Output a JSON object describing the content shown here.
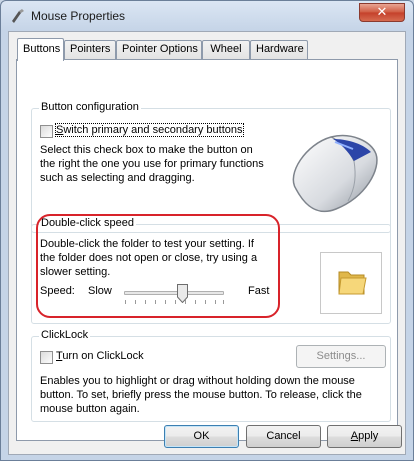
{
  "window": {
    "title": "Mouse Properties",
    "close_glyph": "✕"
  },
  "tabs": [
    {
      "label": "Buttons",
      "active": true
    },
    {
      "label": "Pointers",
      "active": false
    },
    {
      "label": "Pointer Options",
      "active": false
    },
    {
      "label": "Wheel",
      "active": false
    },
    {
      "label": "Hardware",
      "active": false
    }
  ],
  "button_configuration": {
    "label": "Button configuration",
    "checkbox_label": "Switch primary and secondary buttons",
    "checked": false,
    "description": "Select this check box to make the button on the right the one you use for primary functions such as selecting and dragging."
  },
  "double_click": {
    "label": "Double-click speed",
    "description": "Double-click the folder to test your setting. If the folder does not open or close, try using a slower setting.",
    "speed_label": "Speed:",
    "slow_label": "Slow",
    "fast_label": "Fast",
    "speed_value_fraction": 0.58
  },
  "clicklock": {
    "label": "ClickLock",
    "checkbox_label": "Turn on ClickLock",
    "checked": false,
    "settings_button": "Settings...",
    "description": "Enables you to highlight or drag without holding down the mouse button. To set, briefly press the mouse button. To release, click the mouse button again."
  },
  "footer": {
    "ok": "OK",
    "cancel": "Cancel",
    "apply": "Apply"
  },
  "icons": {
    "title": "mouse-pointer-icon",
    "preview": "mouse-preview-icon",
    "test": "folder-icon"
  },
  "colors": {
    "highlight": "#d8232a",
    "accent": "#3c7fb1"
  }
}
